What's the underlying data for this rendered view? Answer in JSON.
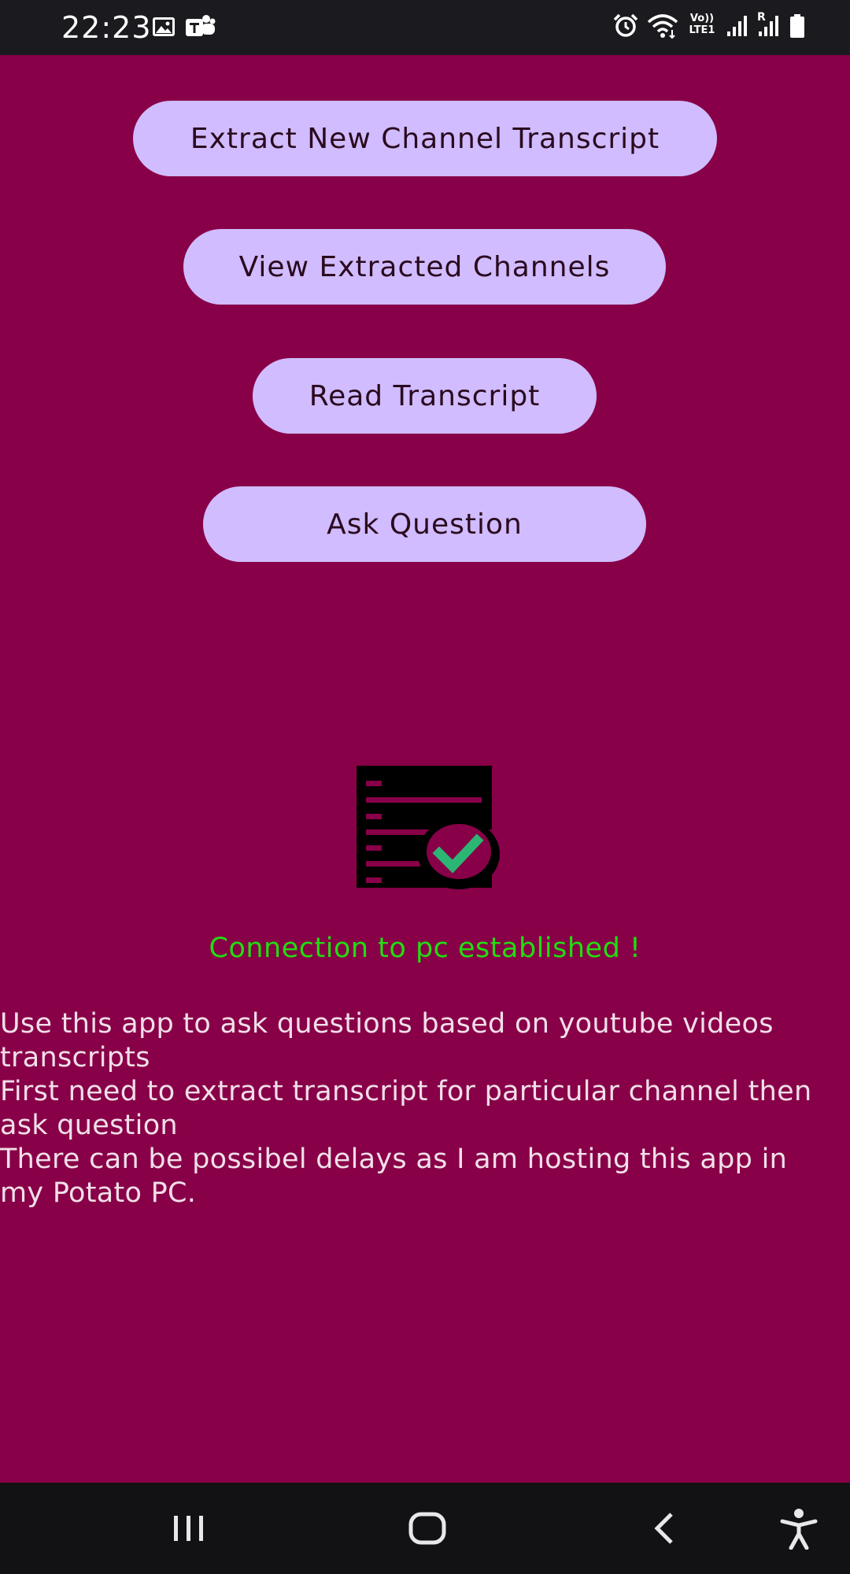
{
  "status_bar": {
    "time": "22:23",
    "left_icons": [
      "gallery-icon",
      "teams-icon"
    ],
    "right_icons": [
      "alarm-icon",
      "wifi-icon",
      "volte-icon",
      "signal-icon",
      "signal-roaming-icon",
      "battery-icon"
    ],
    "volte_label_top": "Vo))",
    "volte_label_bottom": "LTE1",
    "roaming_label": "R"
  },
  "actions": {
    "extract_label": "Extract New Channel Transcript",
    "view_label": "View Extracted Channels",
    "read_label": "Read Transcript",
    "ask_label": "Ask Question"
  },
  "status": {
    "message": "Connection to pc established !",
    "icon": "server-check-icon"
  },
  "info": {
    "lines": [
      "Use this app to ask questions based on youtube videos transcripts",
      "First need to extract transcript for particular channel then ask question",
      "There can be possibel delays as I am hosting this app in my Potato PC."
    ]
  },
  "nav": {
    "icons": [
      "recents-icon",
      "home-icon",
      "back-icon",
      "accessibility-icon"
    ]
  },
  "colors": {
    "background": "#880048",
    "button": "#d0bcff",
    "success_text": "#22dd11",
    "check_green": "#2bb673"
  }
}
